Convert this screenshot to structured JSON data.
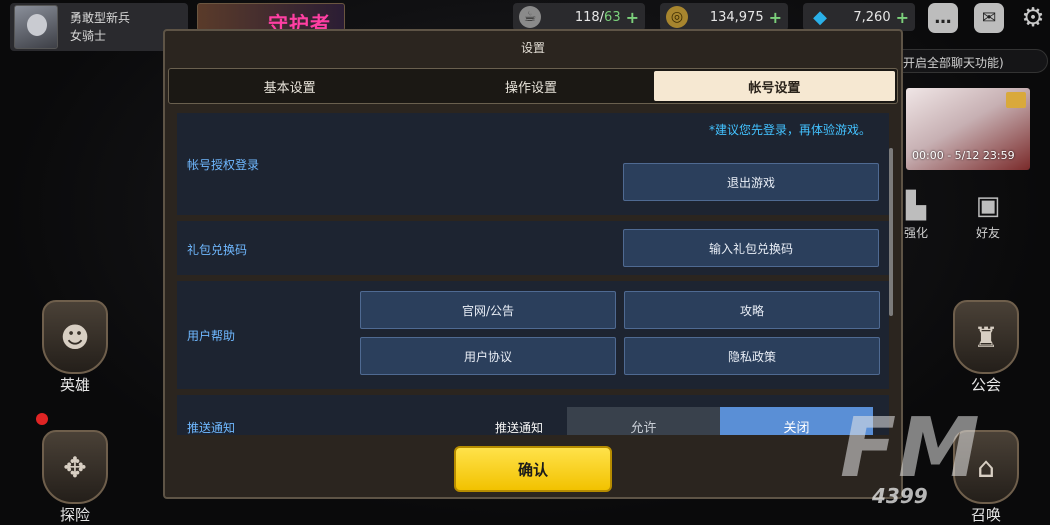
{
  "player": {
    "title": "勇敢型新兵",
    "class_name": "女骑士"
  },
  "banner": {
    "text": "守护者"
  },
  "resources": {
    "stamina": {
      "current": "118",
      "sep": "/",
      "max": "63",
      "icon": "coffee-icon"
    },
    "gold": {
      "value": "134,975",
      "icon": "coin-icon"
    },
    "gems": {
      "value": "7,260",
      "icon": "gem-icon"
    },
    "plus": "+"
  },
  "top_icons": {
    "chat": "chat-icon",
    "mail": "mail-icon",
    "settings": "gear-icon"
  },
  "chat_hint": "开启全部聊天功能)",
  "event": {
    "time": "00:00 - 5/12 23:59"
  },
  "side": {
    "enhance": "强化",
    "friends": "好友",
    "heroes": "英雄",
    "explore": "探险",
    "guild": "公会",
    "summon": "召唤"
  },
  "watermark": {
    "brand": "FM",
    "num": "4399"
  },
  "dialog": {
    "title": "设置",
    "tabs": [
      {
        "label": "基本设置",
        "active": false
      },
      {
        "label": "操作设置",
        "active": false
      },
      {
        "label": "帐号设置",
        "active": true
      }
    ],
    "account": {
      "label": "帐号授权登录",
      "hint": "*建议您先登录，再体验游戏。",
      "logout": "退出游戏"
    },
    "gift": {
      "label": "礼包兑换码",
      "button": "输入礼包兑换码"
    },
    "help": {
      "label": "用户帮助",
      "buttons": [
        "官网/公告",
        "攻略",
        "用户协议",
        "隐私政策"
      ]
    },
    "push": {
      "label": "推送通知",
      "sub_label": "推送通知",
      "allow": "允许",
      "close": "关闭"
    },
    "confirm": "确认"
  },
  "colors": {
    "dialog_bg": "#2b251f",
    "section_bg": "#1d2431",
    "button_bg": "#2b3f5c",
    "accent_blue_text": "#6fb8ff",
    "hint_cyan": "#43c2ff",
    "active_tab": "#f6e8d2",
    "confirm_yellow": "#ffd60a"
  }
}
